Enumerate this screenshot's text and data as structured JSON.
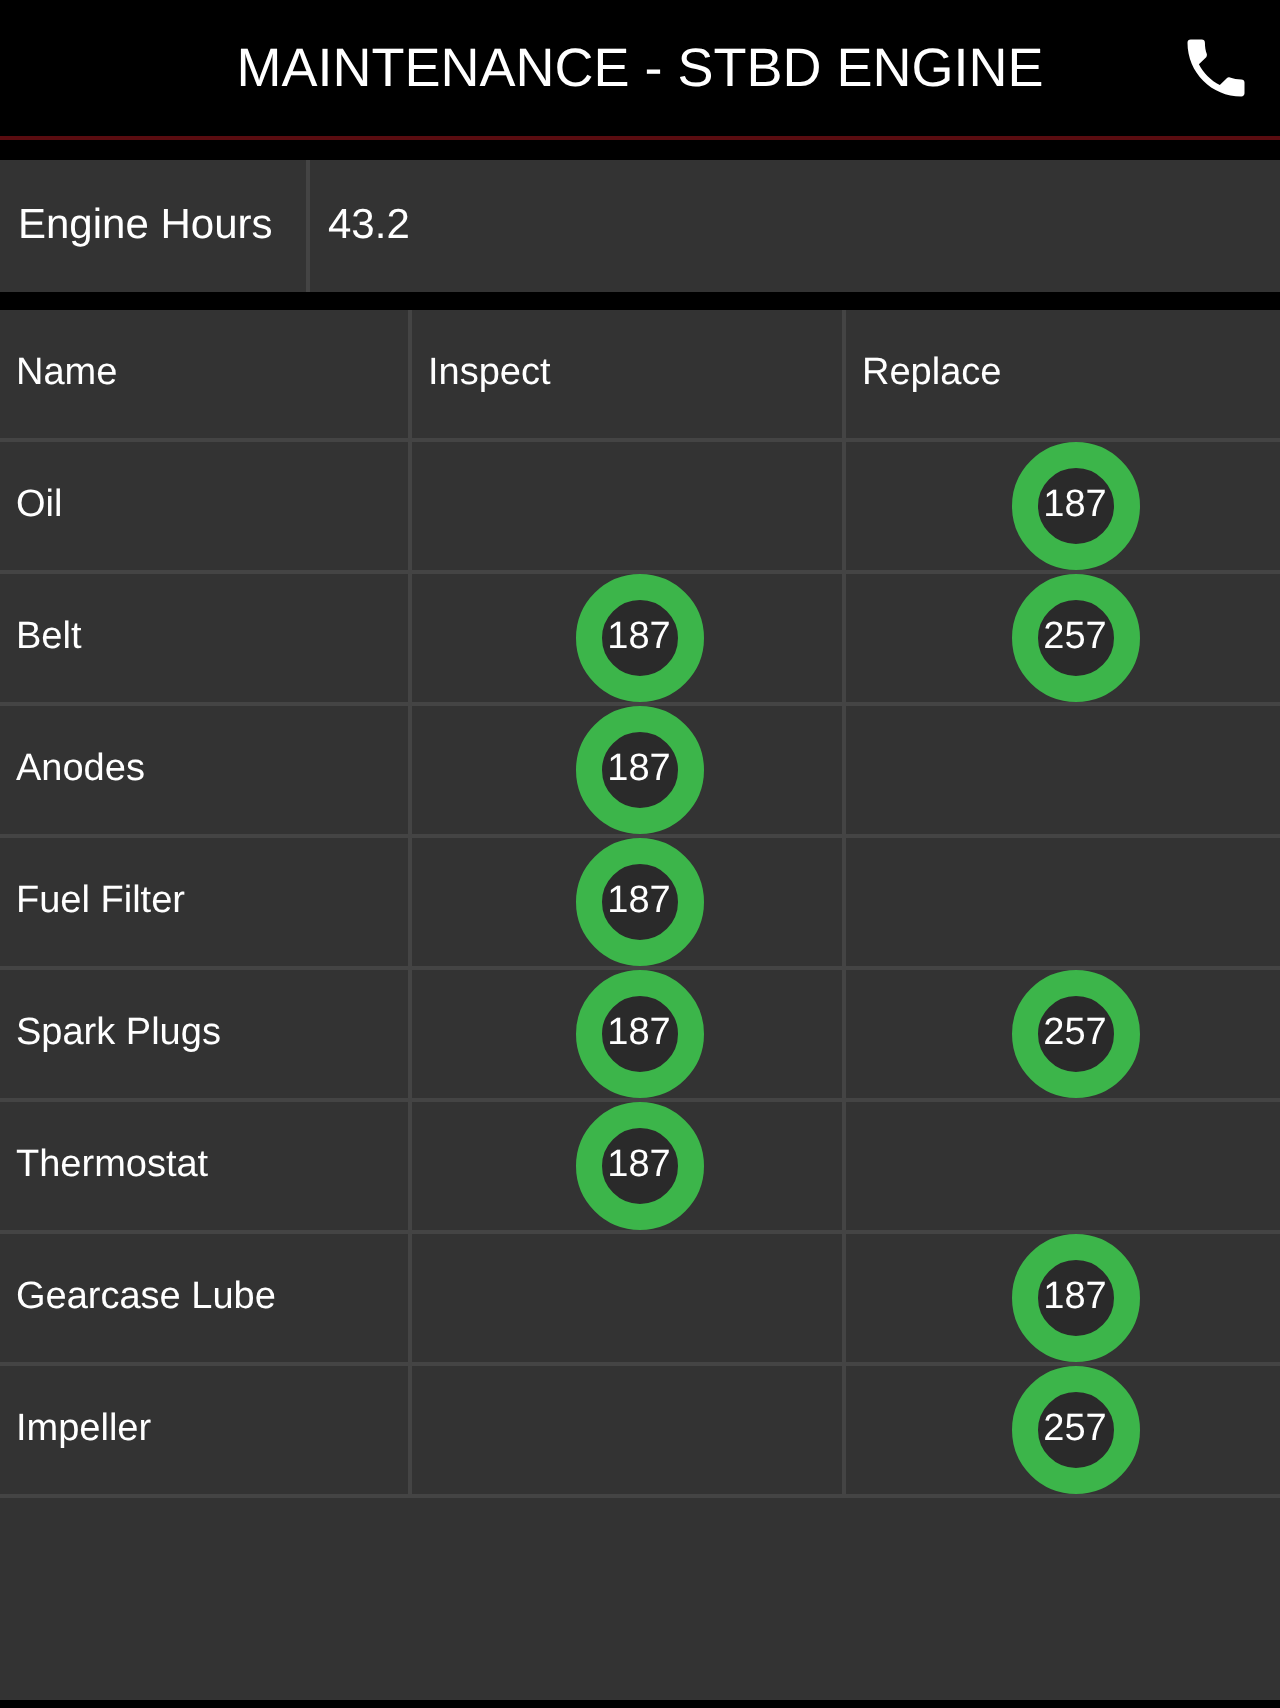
{
  "header": {
    "title": "MAINTENANCE - STBD ENGINE"
  },
  "engine_hours": {
    "label": "Engine Hours",
    "value": "43.2"
  },
  "table": {
    "columns": [
      "Name",
      "Inspect",
      "Replace"
    ],
    "rows": [
      {
        "name": "Oil",
        "replace": "187"
      },
      {
        "name": "Belt",
        "inspect": "187",
        "replace": "257"
      },
      {
        "name": "Anodes",
        "inspect": "187"
      },
      {
        "name": "Fuel Filter",
        "inspect": "187"
      },
      {
        "name": "Spark Plugs",
        "inspect": "187",
        "replace": "257"
      },
      {
        "name": "Thermostat",
        "inspect": "187"
      },
      {
        "name": "Gearcase Lube",
        "replace": "187"
      },
      {
        "name": "Impeller",
        "replace": "257"
      }
    ]
  }
}
